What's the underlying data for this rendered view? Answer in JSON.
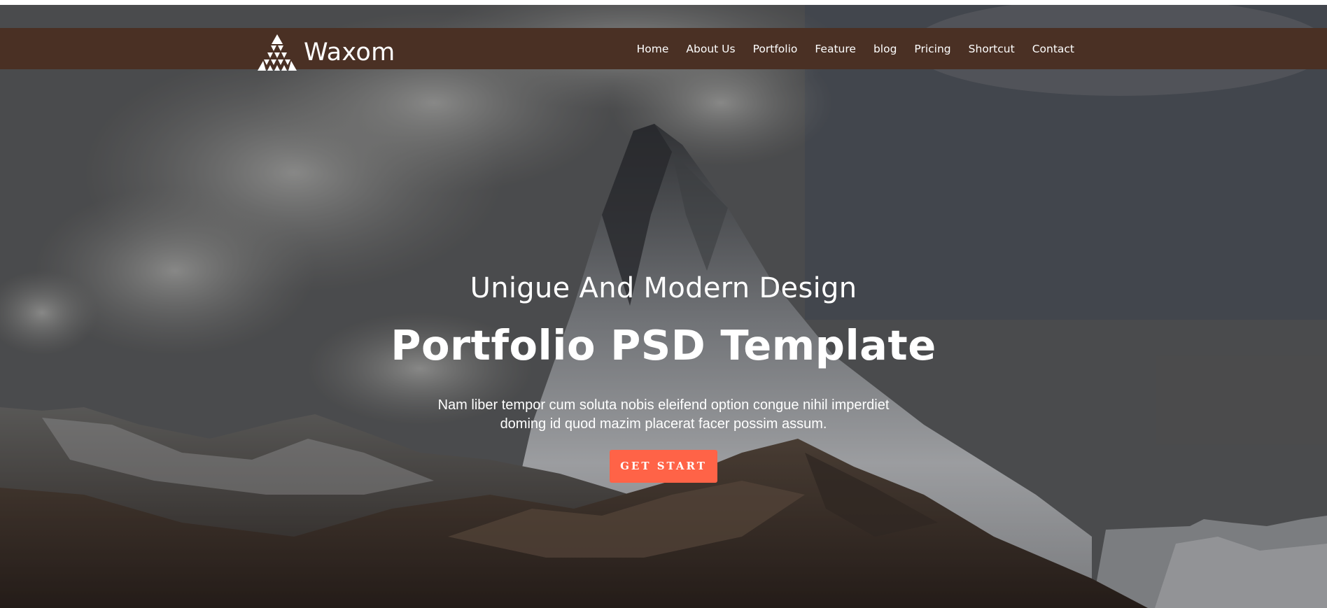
{
  "brand": {
    "name": "Waxom",
    "logo_icon": "triangle-mosaic-logo-icon"
  },
  "nav": {
    "items": [
      {
        "label": "Home"
      },
      {
        "label": "About Us"
      },
      {
        "label": "Portfolio"
      },
      {
        "label": "Feature"
      },
      {
        "label": "blog"
      },
      {
        "label": "Pricing"
      },
      {
        "label": "Shortcut"
      },
      {
        "label": "Contact"
      }
    ]
  },
  "hero": {
    "subtitle": "Unigue And Modern Design",
    "title": "Portfolio PSD Template",
    "description_line1": "Nam liber tempor cum soluta nobis eleifend option congue nihil imperdiet",
    "description_line2": "doming id quod mazim placerat facer possim assum.",
    "cta_label": "GET START",
    "background": "mountain-peak-photo"
  },
  "colors": {
    "navbar": "#4a3024",
    "cta": "#ff6347",
    "text": "#ffffff"
  }
}
